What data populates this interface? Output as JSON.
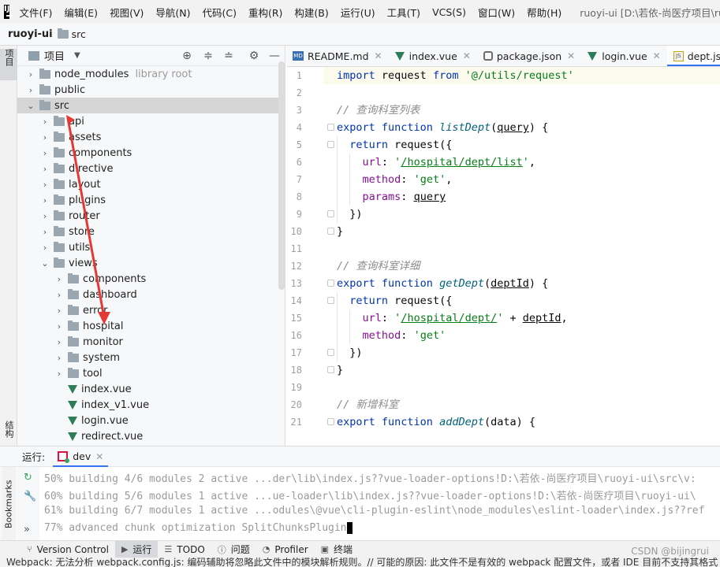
{
  "menubar": {
    "logo_text": "IJ",
    "items": [
      "文件(F)",
      "编辑(E)",
      "视图(V)",
      "导航(N)",
      "代码(C)",
      "重构(R)",
      "构建(B)",
      "运行(U)",
      "工具(T)",
      "VCS(S)",
      "窗口(W)",
      "帮助(H)"
    ],
    "window_title": "ruoyi-ui [D:\\若依-尚医疗项目\\ruoyi-ui] - d"
  },
  "navbar": {
    "project": "ruoyi-ui",
    "folder": "src"
  },
  "left_strip": {
    "project_tab": "项目",
    "structure_tab": "结构"
  },
  "project_panel": {
    "title": "项目",
    "tree": [
      {
        "label": "node_modules",
        "suffix": "library root",
        "depth": 1,
        "type": "folder",
        "expanded": false
      },
      {
        "label": "public",
        "depth": 1,
        "type": "folder",
        "expanded": false
      },
      {
        "label": "src",
        "depth": 1,
        "type": "folder",
        "expanded": true,
        "selected": true
      },
      {
        "label": "api",
        "depth": 2,
        "type": "folder",
        "expanded": false
      },
      {
        "label": "assets",
        "depth": 2,
        "type": "folder",
        "expanded": false
      },
      {
        "label": "components",
        "depth": 2,
        "type": "folder",
        "expanded": false
      },
      {
        "label": "directive",
        "depth": 2,
        "type": "folder",
        "expanded": false
      },
      {
        "label": "layout",
        "depth": 2,
        "type": "folder",
        "expanded": false
      },
      {
        "label": "plugins",
        "depth": 2,
        "type": "folder",
        "expanded": false
      },
      {
        "label": "router",
        "depth": 2,
        "type": "folder",
        "expanded": false
      },
      {
        "label": "store",
        "depth": 2,
        "type": "folder",
        "expanded": false
      },
      {
        "label": "utils",
        "depth": 2,
        "type": "folder",
        "expanded": false
      },
      {
        "label": "views",
        "depth": 2,
        "type": "folder",
        "expanded": true
      },
      {
        "label": "components",
        "depth": 3,
        "type": "folder",
        "expanded": false
      },
      {
        "label": "dashboard",
        "depth": 3,
        "type": "folder",
        "expanded": false
      },
      {
        "label": "error",
        "depth": 3,
        "type": "folder",
        "expanded": false
      },
      {
        "label": "hospital",
        "depth": 3,
        "type": "folder",
        "expanded": false
      },
      {
        "label": "monitor",
        "depth": 3,
        "type": "folder",
        "expanded": false
      },
      {
        "label": "system",
        "depth": 3,
        "type": "folder",
        "expanded": false
      },
      {
        "label": "tool",
        "depth": 3,
        "type": "folder",
        "expanded": false
      },
      {
        "label": "index.vue",
        "depth": 3,
        "type": "vue"
      },
      {
        "label": "index_v1.vue",
        "depth": 3,
        "type": "vue"
      },
      {
        "label": "login.vue",
        "depth": 3,
        "type": "vue"
      },
      {
        "label": "redirect.vue",
        "depth": 3,
        "type": "vue"
      }
    ]
  },
  "editor_tabs": [
    {
      "label": "README.md",
      "icon": "markdown-icon",
      "active": false
    },
    {
      "label": "index.vue",
      "icon": "vue-icon",
      "active": false
    },
    {
      "label": "package.json",
      "icon": "json-icon",
      "active": false
    },
    {
      "label": "login.vue",
      "icon": "vue-icon",
      "active": false
    },
    {
      "label": "dept.js",
      "icon": "js-icon",
      "active": true
    }
  ],
  "editor": {
    "line_numbers": [
      "1",
      "2",
      "3",
      "4",
      "5",
      "6",
      "7",
      "8",
      "9",
      "10",
      "11",
      "12",
      "13",
      "14",
      "15",
      "16",
      "17",
      "18",
      "19",
      "20",
      "21"
    ],
    "lines": [
      [
        [
          "kw",
          "import"
        ],
        [
          "t",
          " request "
        ],
        [
          "kw",
          "from"
        ],
        [
          "t",
          " "
        ],
        [
          "str",
          "'@/utils/request'"
        ]
      ],
      [],
      [
        [
          "cmt",
          "// 查询科室列表"
        ]
      ],
      [
        [
          "kw",
          "export function"
        ],
        [
          "t",
          " "
        ],
        [
          "fn",
          "listDept"
        ],
        [
          "t",
          "("
        ],
        [
          "param",
          "query"
        ],
        [
          "t",
          ") {"
        ]
      ],
      [
        [
          "t",
          "  "
        ],
        [
          "kw",
          "return"
        ],
        [
          "t",
          " request({"
        ]
      ],
      [
        [
          "t",
          "    "
        ],
        [
          "prop",
          "url"
        ],
        [
          "t",
          ": "
        ],
        [
          "str",
          "'"
        ],
        [
          "str-u",
          "/hospital/dept/list"
        ],
        [
          "str",
          "'"
        ],
        [
          "t",
          ","
        ]
      ],
      [
        [
          "t",
          "    "
        ],
        [
          "prop",
          "method"
        ],
        [
          "t",
          ": "
        ],
        [
          "str",
          "'get'"
        ],
        [
          "t",
          ","
        ]
      ],
      [
        [
          "t",
          "    "
        ],
        [
          "prop",
          "params"
        ],
        [
          "t",
          ": "
        ],
        [
          "param",
          "query"
        ]
      ],
      [
        [
          "t",
          "  })"
        ]
      ],
      [
        [
          "t",
          "}"
        ]
      ],
      [],
      [
        [
          "cmt",
          "// 查询科室详细"
        ]
      ],
      [
        [
          "kw",
          "export function"
        ],
        [
          "t",
          " "
        ],
        [
          "fn",
          "getDept"
        ],
        [
          "t",
          "("
        ],
        [
          "param",
          "deptId"
        ],
        [
          "t",
          ") {"
        ]
      ],
      [
        [
          "t",
          "  "
        ],
        [
          "kw",
          "return"
        ],
        [
          "t",
          " request({"
        ]
      ],
      [
        [
          "t",
          "    "
        ],
        [
          "prop",
          "url"
        ],
        [
          "t",
          ": "
        ],
        [
          "str",
          "'"
        ],
        [
          "str-u",
          "/hospital/dept/"
        ],
        [
          "str",
          "'"
        ],
        [
          "t",
          " + "
        ],
        [
          "param",
          "deptId"
        ],
        [
          "t",
          ","
        ]
      ],
      [
        [
          "t",
          "    "
        ],
        [
          "prop",
          "method"
        ],
        [
          "t",
          ": "
        ],
        [
          "str",
          "'get'"
        ]
      ],
      [
        [
          "t",
          "  })"
        ]
      ],
      [
        [
          "t",
          "}"
        ]
      ],
      [],
      [
        [
          "cmt",
          "// 新增科室"
        ]
      ],
      [
        [
          "kw",
          "export function"
        ],
        [
          "t",
          " "
        ],
        [
          "fn",
          "addDept"
        ],
        [
          "t",
          "(data) {"
        ]
      ]
    ]
  },
  "run_panel": {
    "label": "运行:",
    "tab": "dev",
    "bookmarks_label": "Bookmarks",
    "console": [
      "50% building 4/6 modules 2 active ...der\\lib\\index.js??vue-loader-options!D:\\若依-尚医疗项目\\ruoyi-ui\\src\\v:",
      "60% building 5/6 modules 1 active ...ue-loader\\lib\\index.js??vue-loader-options!D:\\若依-尚医疗项目\\ruoyi-ui\\",
      "61% building 6/7 modules 1 active ...odules\\@vue\\cli-plugin-eslint\\node_modules\\eslint-loader\\index.js??ref",
      "77% advanced chunk optimization SplitChunksPlugin"
    ]
  },
  "tool_windows": [
    {
      "label": "Version Control",
      "icon": "branch-icon",
      "active": false
    },
    {
      "label": "运行",
      "icon": "run-icon",
      "active": true
    },
    {
      "label": "TODO",
      "icon": "list-icon",
      "active": false
    },
    {
      "label": "问题",
      "icon": "info-icon",
      "active": false
    },
    {
      "label": "Profiler",
      "icon": "profiler-icon",
      "active": false
    },
    {
      "label": "终端",
      "icon": "terminal-icon",
      "active": false
    }
  ],
  "watermark": "CSDN @bijingrui",
  "statusbar": {
    "text": "Webpack: 无法分析 webpack.config.js: 编码辅助将忽略此文件中的模块解析规则。// 可能的原因: 此文件不是有效的 webpack 配置文件，或者 IDE 目前不支持其格式"
  },
  "annotation": {
    "color": "#e53935"
  }
}
